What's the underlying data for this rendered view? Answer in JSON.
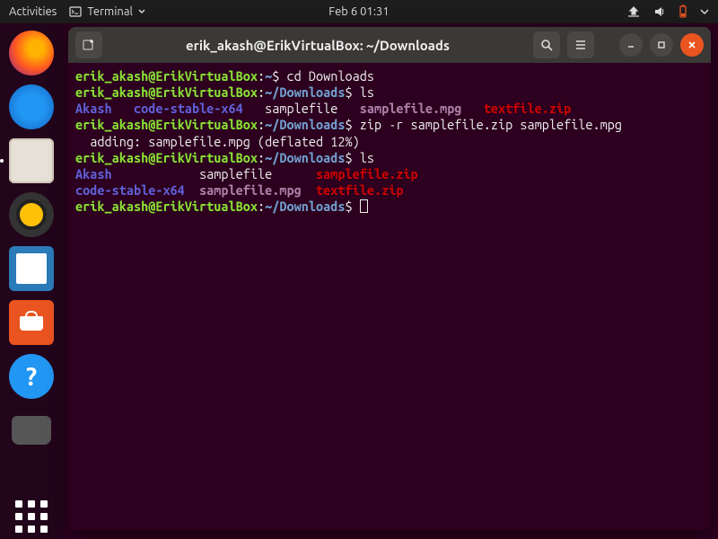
{
  "topbar": {
    "activities": "Activities",
    "terminal": "Terminal",
    "datetime": "Feb 6  01:31"
  },
  "window": {
    "title": "erik_akash@ErikVirtualBox: ~/Downloads"
  },
  "prompt": {
    "user": "erik_akash",
    "at": "@",
    "host": "ErikVirtualBox",
    "colon": ":",
    "home_path": "~",
    "dl_path": "~/Downloads",
    "dollar": "$"
  },
  "cmd": {
    "cd": " cd Downloads",
    "ls1": " ls",
    "zip": " zip -r samplefile.zip samplefile.mpg",
    "ls2": " ls"
  },
  "output": {
    "ls1_dir1": "Akash",
    "ls1_dir2": "code-stable-x64",
    "ls1_file1": "samplefile",
    "ls1_media": "samplefile.mpg",
    "ls1_zip": "textfile.zip",
    "zip_line": "  adding: samplefile.mpg (deflated 12%)",
    "ls2_dir1": "Akash",
    "ls2_file1": "samplefile",
    "ls2_zip1": "samplefile.zip",
    "ls2_dir2": "code-stable-x64",
    "ls2_media": "samplefile.mpg",
    "ls2_zip2": "textfile.zip"
  },
  "help_glyph": "?"
}
